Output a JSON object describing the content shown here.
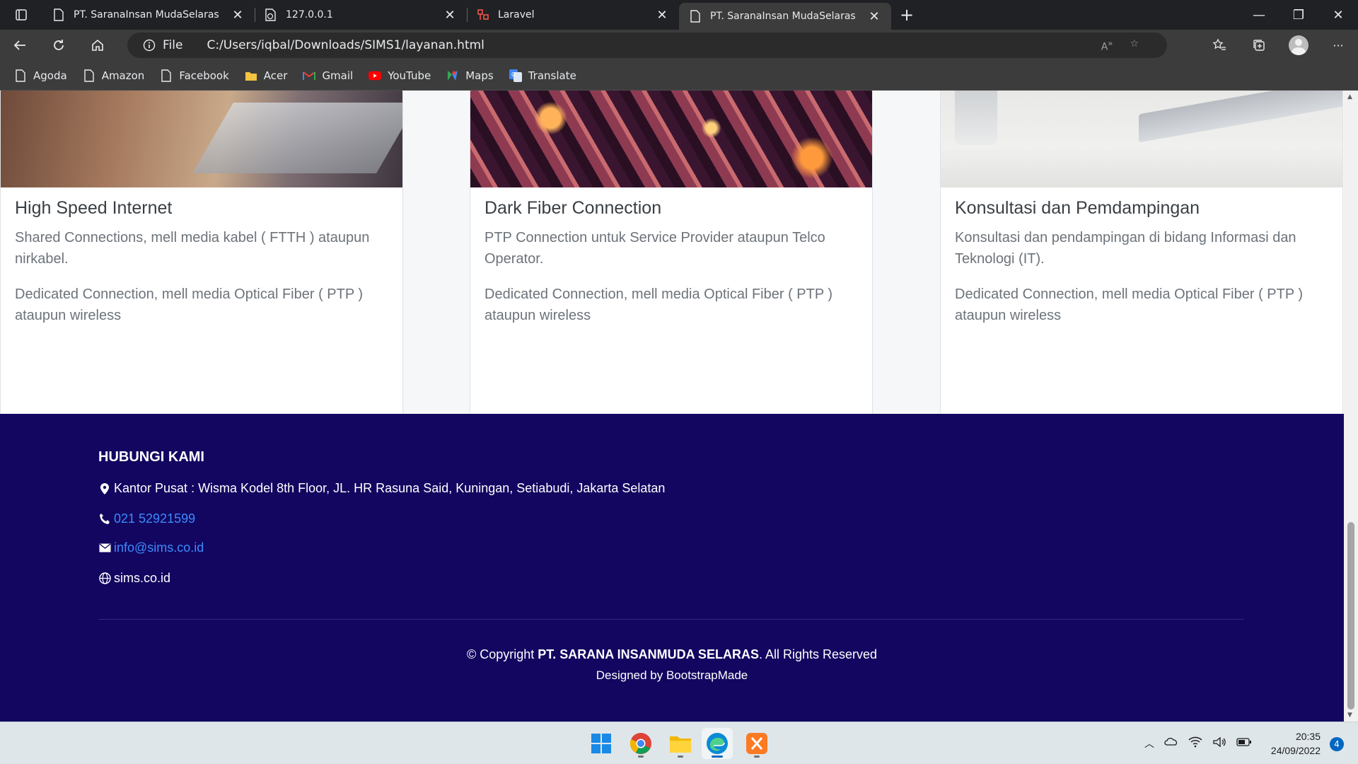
{
  "browser": {
    "tabs": [
      {
        "title": "PT. SaranaInsan MudaSelaras",
        "icon": "page-icon",
        "active": false
      },
      {
        "title": "127.0.0.1",
        "icon": "globe-doc-icon",
        "active": false
      },
      {
        "title": "Laravel",
        "icon": "laravel-icon",
        "active": false
      },
      {
        "title": "PT. SaranaInsan MudaSelaras",
        "icon": "page-icon",
        "active": true
      }
    ],
    "new_tab_symbol": "+",
    "address": {
      "scheme_label": "File",
      "url": "C:/Users/iqbal/Downloads/SIMS1/layanan.html"
    },
    "bookmarks": [
      {
        "label": "Agoda",
        "icon": "page-icon"
      },
      {
        "label": "Amazon",
        "icon": "page-icon"
      },
      {
        "label": "Facebook",
        "icon": "page-icon"
      },
      {
        "label": "Acer",
        "icon": "folder-icon"
      },
      {
        "label": "Gmail",
        "icon": "gmail-icon"
      },
      {
        "label": "YouTube",
        "icon": "youtube-icon"
      },
      {
        "label": "Maps",
        "icon": "maps-icon"
      },
      {
        "label": "Translate",
        "icon": "translate-icon"
      }
    ]
  },
  "services": [
    {
      "title": "High Speed Internet",
      "desc1": "Shared Connections, mell media kabel ( FTTH ) ataupun nirkabel.",
      "desc2": "Dedicated Connection, mell media Optical Fiber ( PTP ) ataupun wireless",
      "image": "hands-on-tablet"
    },
    {
      "title": "Dark Fiber Connection",
      "desc1": "PTP Connection untuk Service Provider ataupun Telco Operator.",
      "desc2": "Dedicated Connection, mell media Optical Fiber ( PTP ) ataupun wireless",
      "image": "fiber-optic-strands"
    },
    {
      "title": "Konsultasi dan Pemdampingan",
      "desc1": "Konsultasi dan pendampingan di bidang Informasi dan Teknologi (IT).",
      "desc2": "Dedicated Connection, mell media Optical Fiber ( PTP ) ataupun wireless",
      "image": "laptop-on-desk"
    }
  ],
  "footer": {
    "heading": "HUBUNGI KAMI",
    "address": "Kantor Pusat : Wisma Kodel 8th Floor, JL. HR Rasuna Said, Kuningan, Setiabudi, Jakarta Selatan",
    "phone": "021 52921599",
    "email": "info@sims.co.id",
    "website": "sims.co.id",
    "copyright_prefix": "© Copyright ",
    "company": "PT. SARANA INSANMUDA SELARAS",
    "copyright_suffix": ". All Rights Reserved",
    "designed_by": "Designed by BootstrapMade"
  },
  "taskbar": {
    "apps": [
      "windows-start-icon",
      "chrome-icon",
      "file-explorer-icon",
      "edge-icon",
      "xampp-icon"
    ],
    "time": "20:35",
    "date": "24/09/2022",
    "notifications": "4"
  },
  "colors": {
    "footer_bg": "#120660",
    "link": "#3d8bfd",
    "chrome_dark": "#202124",
    "toolbar": "#3c3c3c"
  }
}
